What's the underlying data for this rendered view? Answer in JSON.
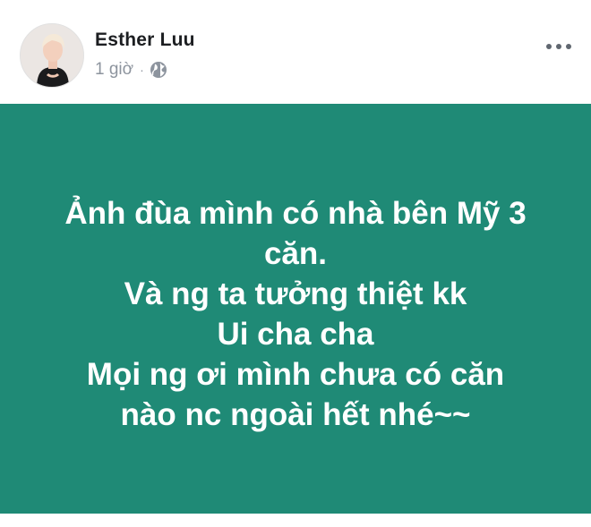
{
  "post": {
    "author_name": "Esther Luu",
    "timestamp": "1 giờ",
    "separator": "·",
    "privacy_icon": "globe-icon",
    "more_icon": "more-horizontal-icon",
    "status_text_lines": [
      "Ảnh đùa mình có nhà bên Mỹ 3",
      "căn.",
      "Và ng ta tưởng thiệt kk",
      "Ui cha cha",
      "Mọi ng ơi mình chưa có căn",
      "nào nc ngoài hết nhé~~"
    ]
  },
  "colors": {
    "status_background": "#1f8a76",
    "status_text": "#ffffff",
    "author_text": "#1c1e21",
    "meta_text": "#8d949e"
  }
}
